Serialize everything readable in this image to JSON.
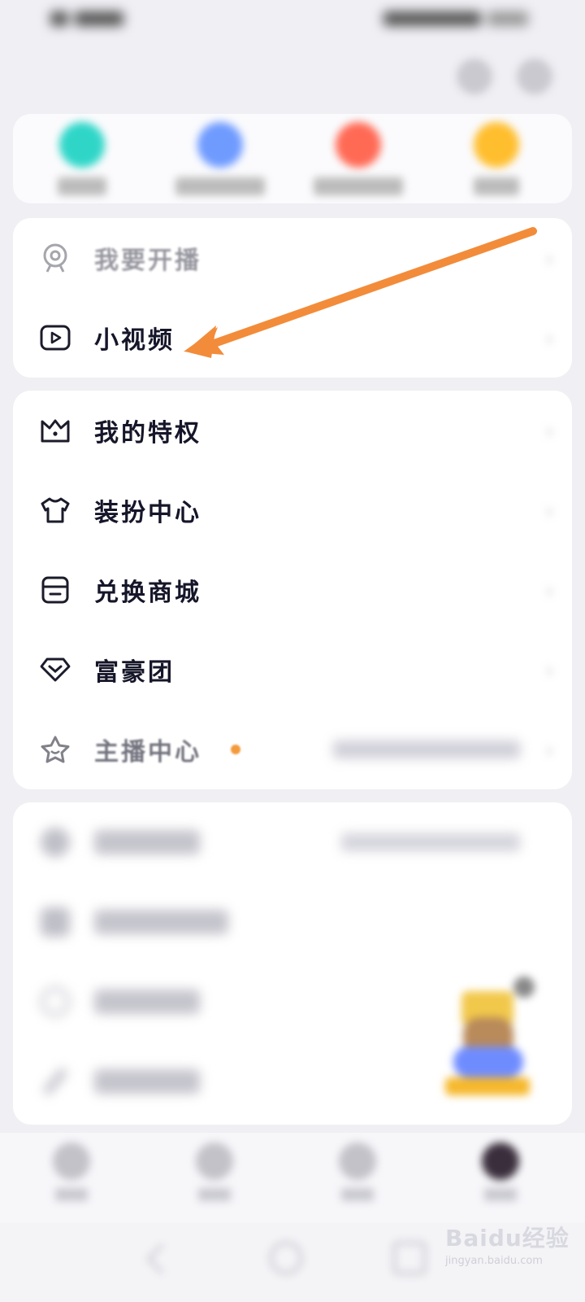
{
  "colors": {
    "accent_arrow": "#f28c3a",
    "quick_teal": "#2fd6c8",
    "quick_blue": "#6f9bff",
    "quick_red": "#ff6a55",
    "quick_yellow": "#ffbe2e",
    "hot_dot": "#f39a3c"
  },
  "header": {
    "icons": [
      "headset-icon",
      "settings-icon"
    ]
  },
  "quick_actions": {
    "items": [
      {
        "icon": "teal-app-icon",
        "label": ""
      },
      {
        "icon": "blue-app-icon",
        "label": ""
      },
      {
        "icon": "red-app-icon",
        "label": ""
      },
      {
        "icon": "yellow-app-icon",
        "label": ""
      }
    ]
  },
  "card1": {
    "rows": [
      {
        "icon": "webcam-icon",
        "label": "我要开播"
      },
      {
        "icon": "video-play-icon",
        "label": "小视频"
      }
    ]
  },
  "card2": {
    "rows": [
      {
        "icon": "crown-icon",
        "label": "我的特权"
      },
      {
        "icon": "tshirt-icon",
        "label": "装扮中心"
      },
      {
        "icon": "store-icon",
        "label": "兑换商城"
      },
      {
        "icon": "diamond-icon",
        "label": "富豪团"
      },
      {
        "icon": "star-icon",
        "label": "主播中心"
      }
    ]
  },
  "card3": {
    "rows": [
      {
        "icon": "circle-icon",
        "label": ""
      },
      {
        "icon": "square-icon",
        "label": ""
      },
      {
        "icon": "info-icon",
        "label": ""
      },
      {
        "icon": "pen-icon",
        "label": ""
      }
    ]
  },
  "bottom_nav": {
    "items": [
      {
        "icon": "home-icon",
        "label": ""
      },
      {
        "icon": "discover-icon",
        "label": ""
      },
      {
        "icon": "message-icon",
        "label": ""
      },
      {
        "icon": "avatar-icon",
        "label": ""
      }
    ]
  },
  "watermark": {
    "main": "Baidu经验",
    "sub": "jingyan.baidu.com"
  }
}
